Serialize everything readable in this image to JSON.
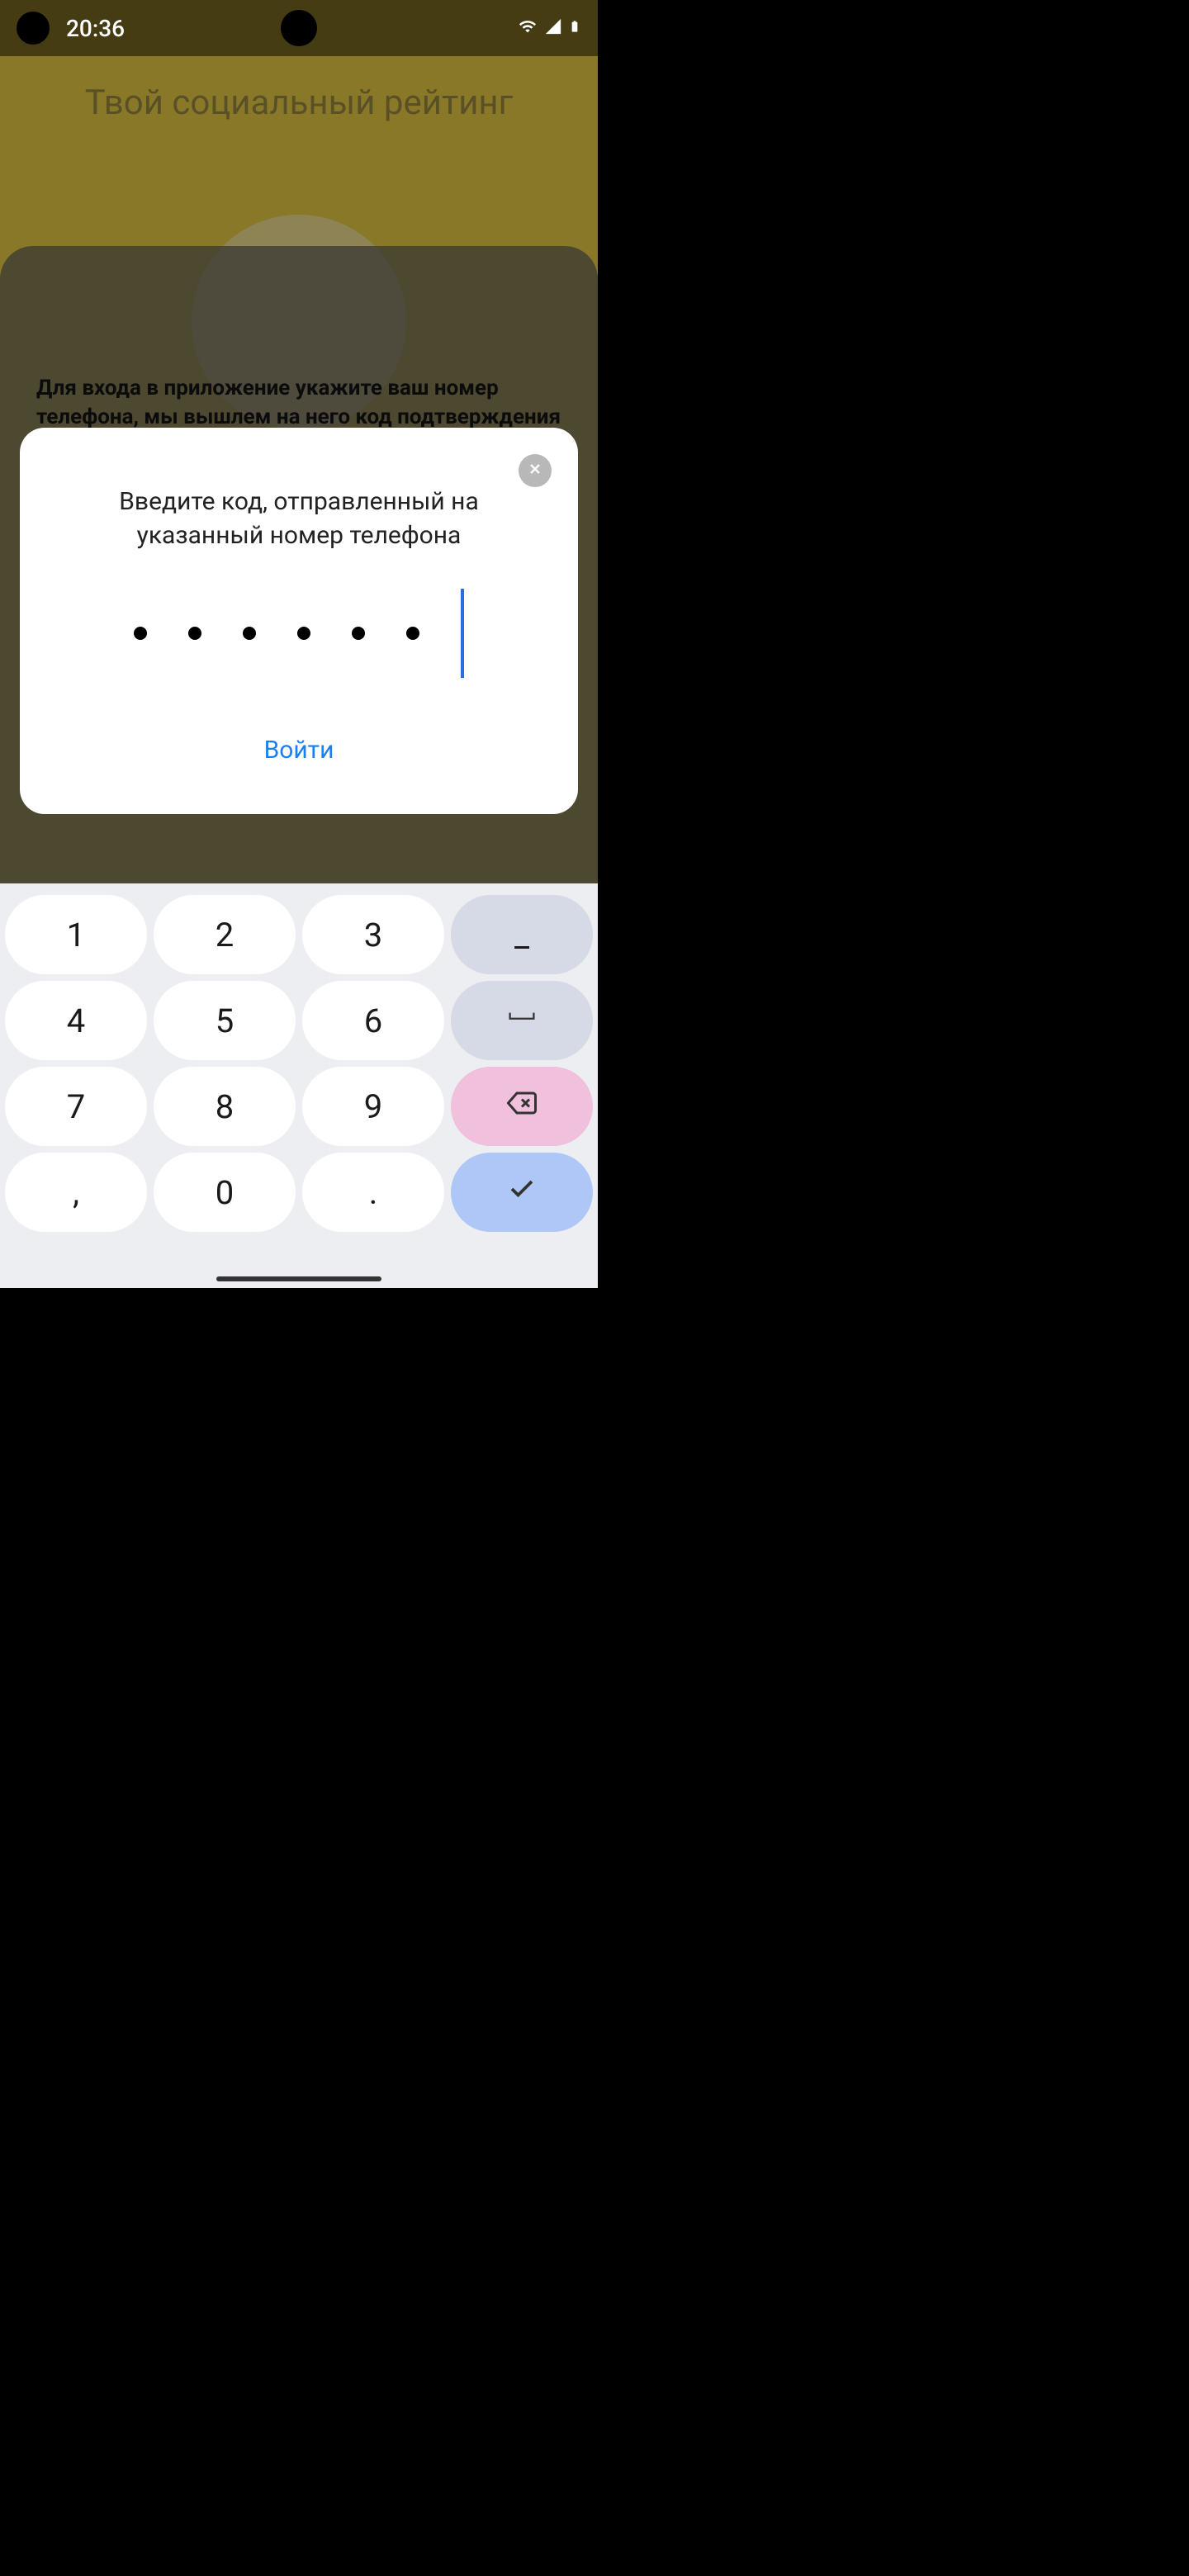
{
  "status": {
    "time": "20:36"
  },
  "background": {
    "title": "Твой социальный рейтинг"
  },
  "phone_panel": {
    "prompt": "Для входа в приложение укажите ваш номер телефона, мы вышлем на него код подтверждения"
  },
  "modal": {
    "title": "Введите код, отправленный на указанный номер телефона",
    "login_label": "Войти",
    "code_length": 6,
    "code_entered": 6
  },
  "keyboard": {
    "keys": {
      "k1": "1",
      "k2": "2",
      "k3": "3",
      "dash": "_",
      "k4": "4",
      "k5": "5",
      "k6": "6",
      "space": "␣",
      "k7": "7",
      "k8": "8",
      "k9": "9",
      "comma": ",",
      "k0": "0",
      "period": "."
    }
  }
}
